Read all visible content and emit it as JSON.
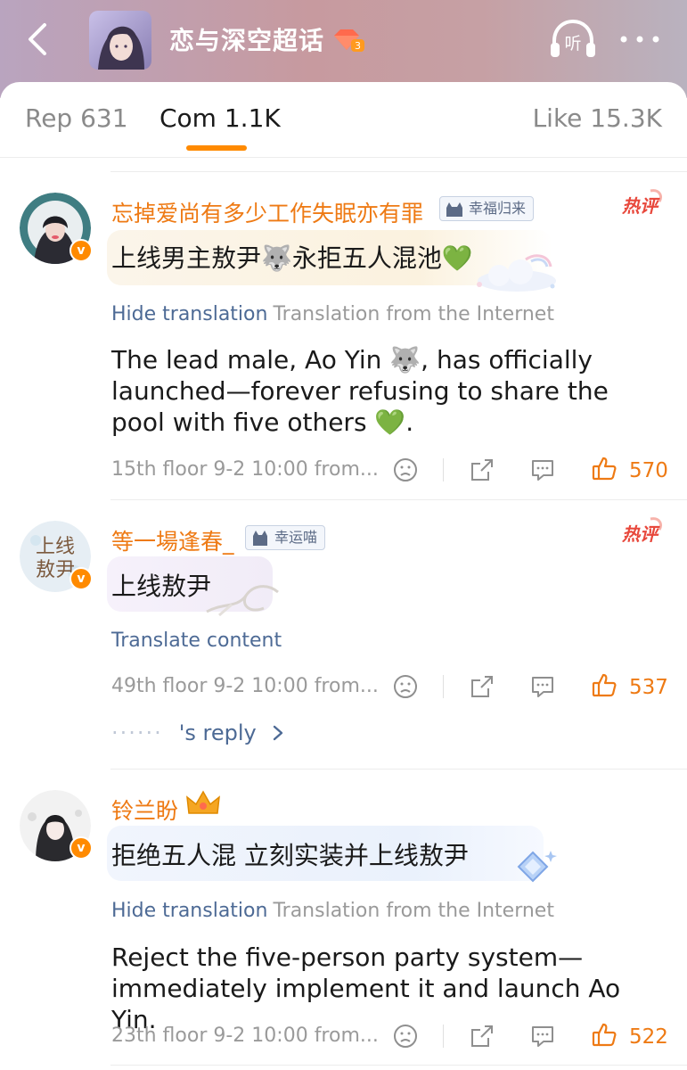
{
  "header": {
    "back_icon": "chevron-left-icon",
    "title": "恋与深空超话",
    "badge_level": "3",
    "listen_label": "听",
    "more_icon": "more-dots-icon"
  },
  "tabs": {
    "reposts": "Rep 631",
    "comments": "Com 1.1K",
    "likes": "Like 15.3K",
    "active_color": "#ff8a00"
  },
  "comments": [
    {
      "username": "忘掉爱尚有多少工作失眠亦有罪",
      "fan_badge": "幸福归来",
      "hot_label": "热评",
      "text": "上线男主敖尹🐺永拒五人混池💚",
      "hide_translation": "Hide translation",
      "translation_source": "Translation from the Internet",
      "translated": "The lead male, Ao Yin 🐺, has officially launched—forever refusing to share the pool with five others 💚.",
      "meta": "15th floor  9-2 10:00  from...",
      "likes": "570"
    },
    {
      "username": "等一場逢春_",
      "fan_badge": "幸运喵",
      "hot_label": "热评",
      "avatar_text": "上线敖尹",
      "text": "上线敖尹",
      "translate_content": "Translate content",
      "meta": "49th floor  9-2 10:00  from...",
      "likes": "537",
      "reply_dots": "······",
      "reply_label": "'s reply"
    },
    {
      "username": "铃兰盼",
      "text": "拒绝五人混 立刻实装并上线敖尹",
      "hide_translation": "Hide translation",
      "translation_source": "Translation from the Internet",
      "translated": "Reject the five-person party system—immediately implement it and launch Ao Yin.",
      "meta": "23th floor  9-2 10:00  from...",
      "likes": "522"
    }
  ],
  "colors": {
    "username": "#ee7a14",
    "link": "#4d6a95",
    "hot": "#e8483c"
  }
}
